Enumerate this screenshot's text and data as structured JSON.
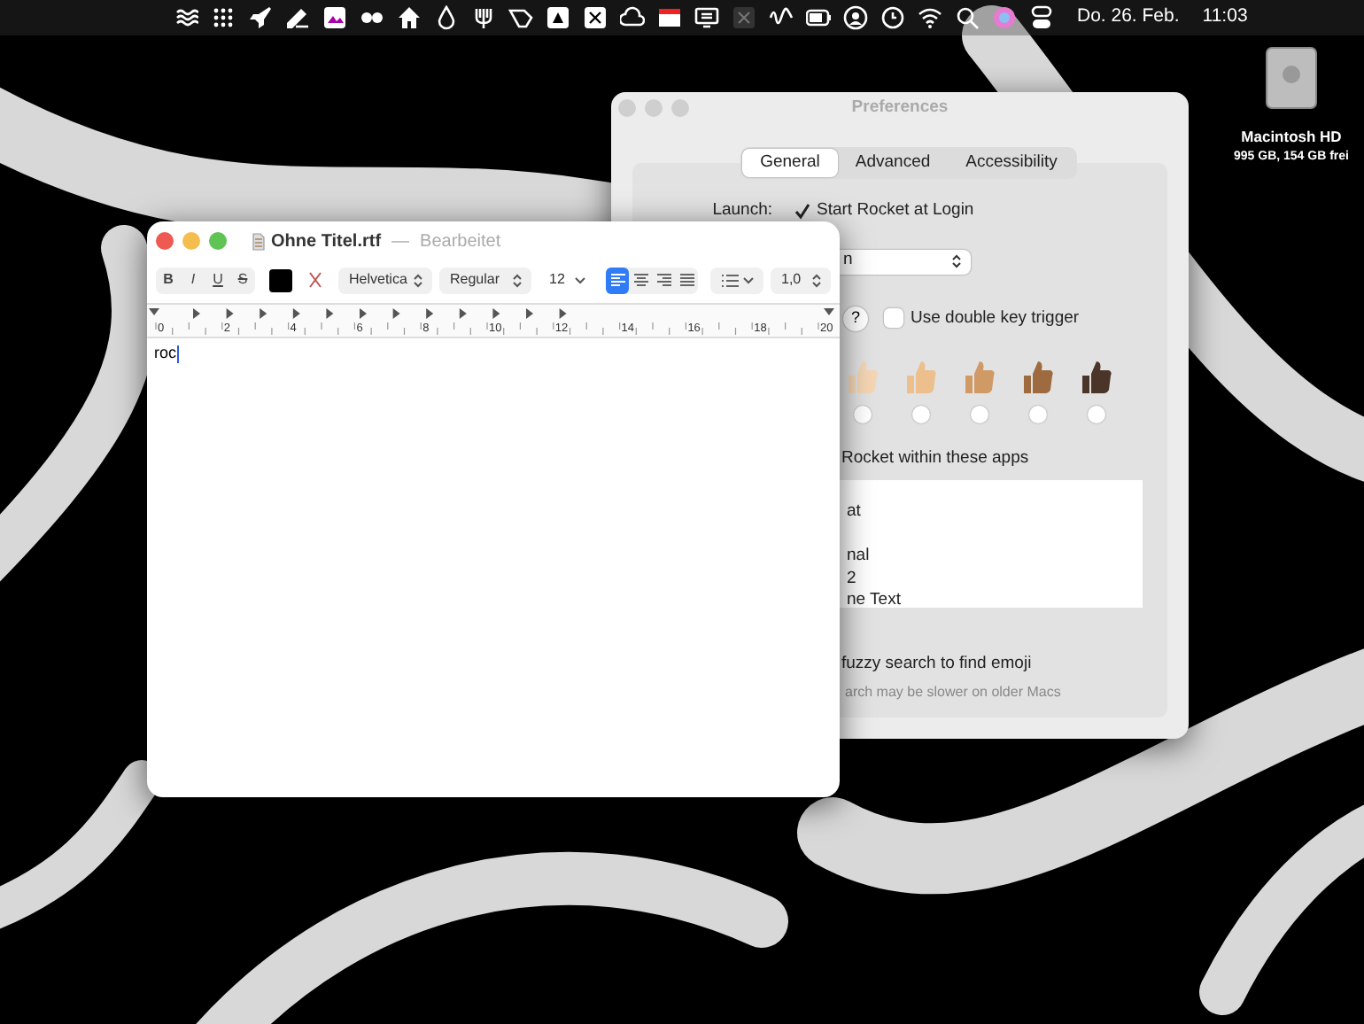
{
  "menu_bar": {
    "date": "Do. 26. Feb.",
    "time": "11:03"
  },
  "desktop_icon": {
    "label": "Macintosh HD",
    "detail": "995 GB, 154 GB frei"
  },
  "preferences": {
    "title": "Preferences",
    "tabs": [
      {
        "label": "General",
        "selected": true
      },
      {
        "label": "Advanced",
        "selected": false
      },
      {
        "label": "Accessibility",
        "selected": false
      }
    ],
    "launch_label": "Launch:",
    "launch_checkbox": {
      "label": "Start Rocket at Login",
      "checked": true
    },
    "dropdown": {
      "value": "n"
    },
    "help": "?",
    "double_key_checkbox": {
      "label": "Use double key trigger",
      "checked": false
    },
    "skin_tones": [
      {
        "color": "#f4d6b4",
        "selected": false
      },
      {
        "color": "#edbf8c",
        "selected": false
      },
      {
        "color": "#cf9a66",
        "selected": false
      },
      {
        "color": "#9e6a3f",
        "selected": false
      },
      {
        "color": "#4b3428",
        "selected": false
      }
    ],
    "apps_label": "Rocket within these apps",
    "apps": [
      "at",
      "nal",
      "2",
      "ne Text"
    ],
    "fuzzy_label": "fuzzy search to find emoji",
    "fuzzy_hint": "arch may be slower on older Macs"
  },
  "textedit": {
    "title": "Ohne Titel.rtf",
    "separator": "—",
    "status": "Bearbeitet",
    "styles": [
      {
        "label": "B",
        "kind": "bold"
      },
      {
        "label": "I",
        "kind": "italic"
      },
      {
        "label": "U",
        "kind": "underline"
      },
      {
        "label": "S",
        "kind": "strike"
      }
    ],
    "font": "Helvetica",
    "typeface": "Regular",
    "size": "12",
    "alignments": [
      {
        "kind": "left",
        "selected": true
      },
      {
        "kind": "center",
        "selected": false
      },
      {
        "kind": "right",
        "selected": false
      },
      {
        "kind": "justify",
        "selected": false
      }
    ],
    "spacing": "1,0",
    "ruler": [
      "0",
      "2",
      "4",
      "6",
      "8",
      "10",
      "12",
      "14",
      "16",
      "18",
      "20"
    ],
    "body": "roc"
  }
}
